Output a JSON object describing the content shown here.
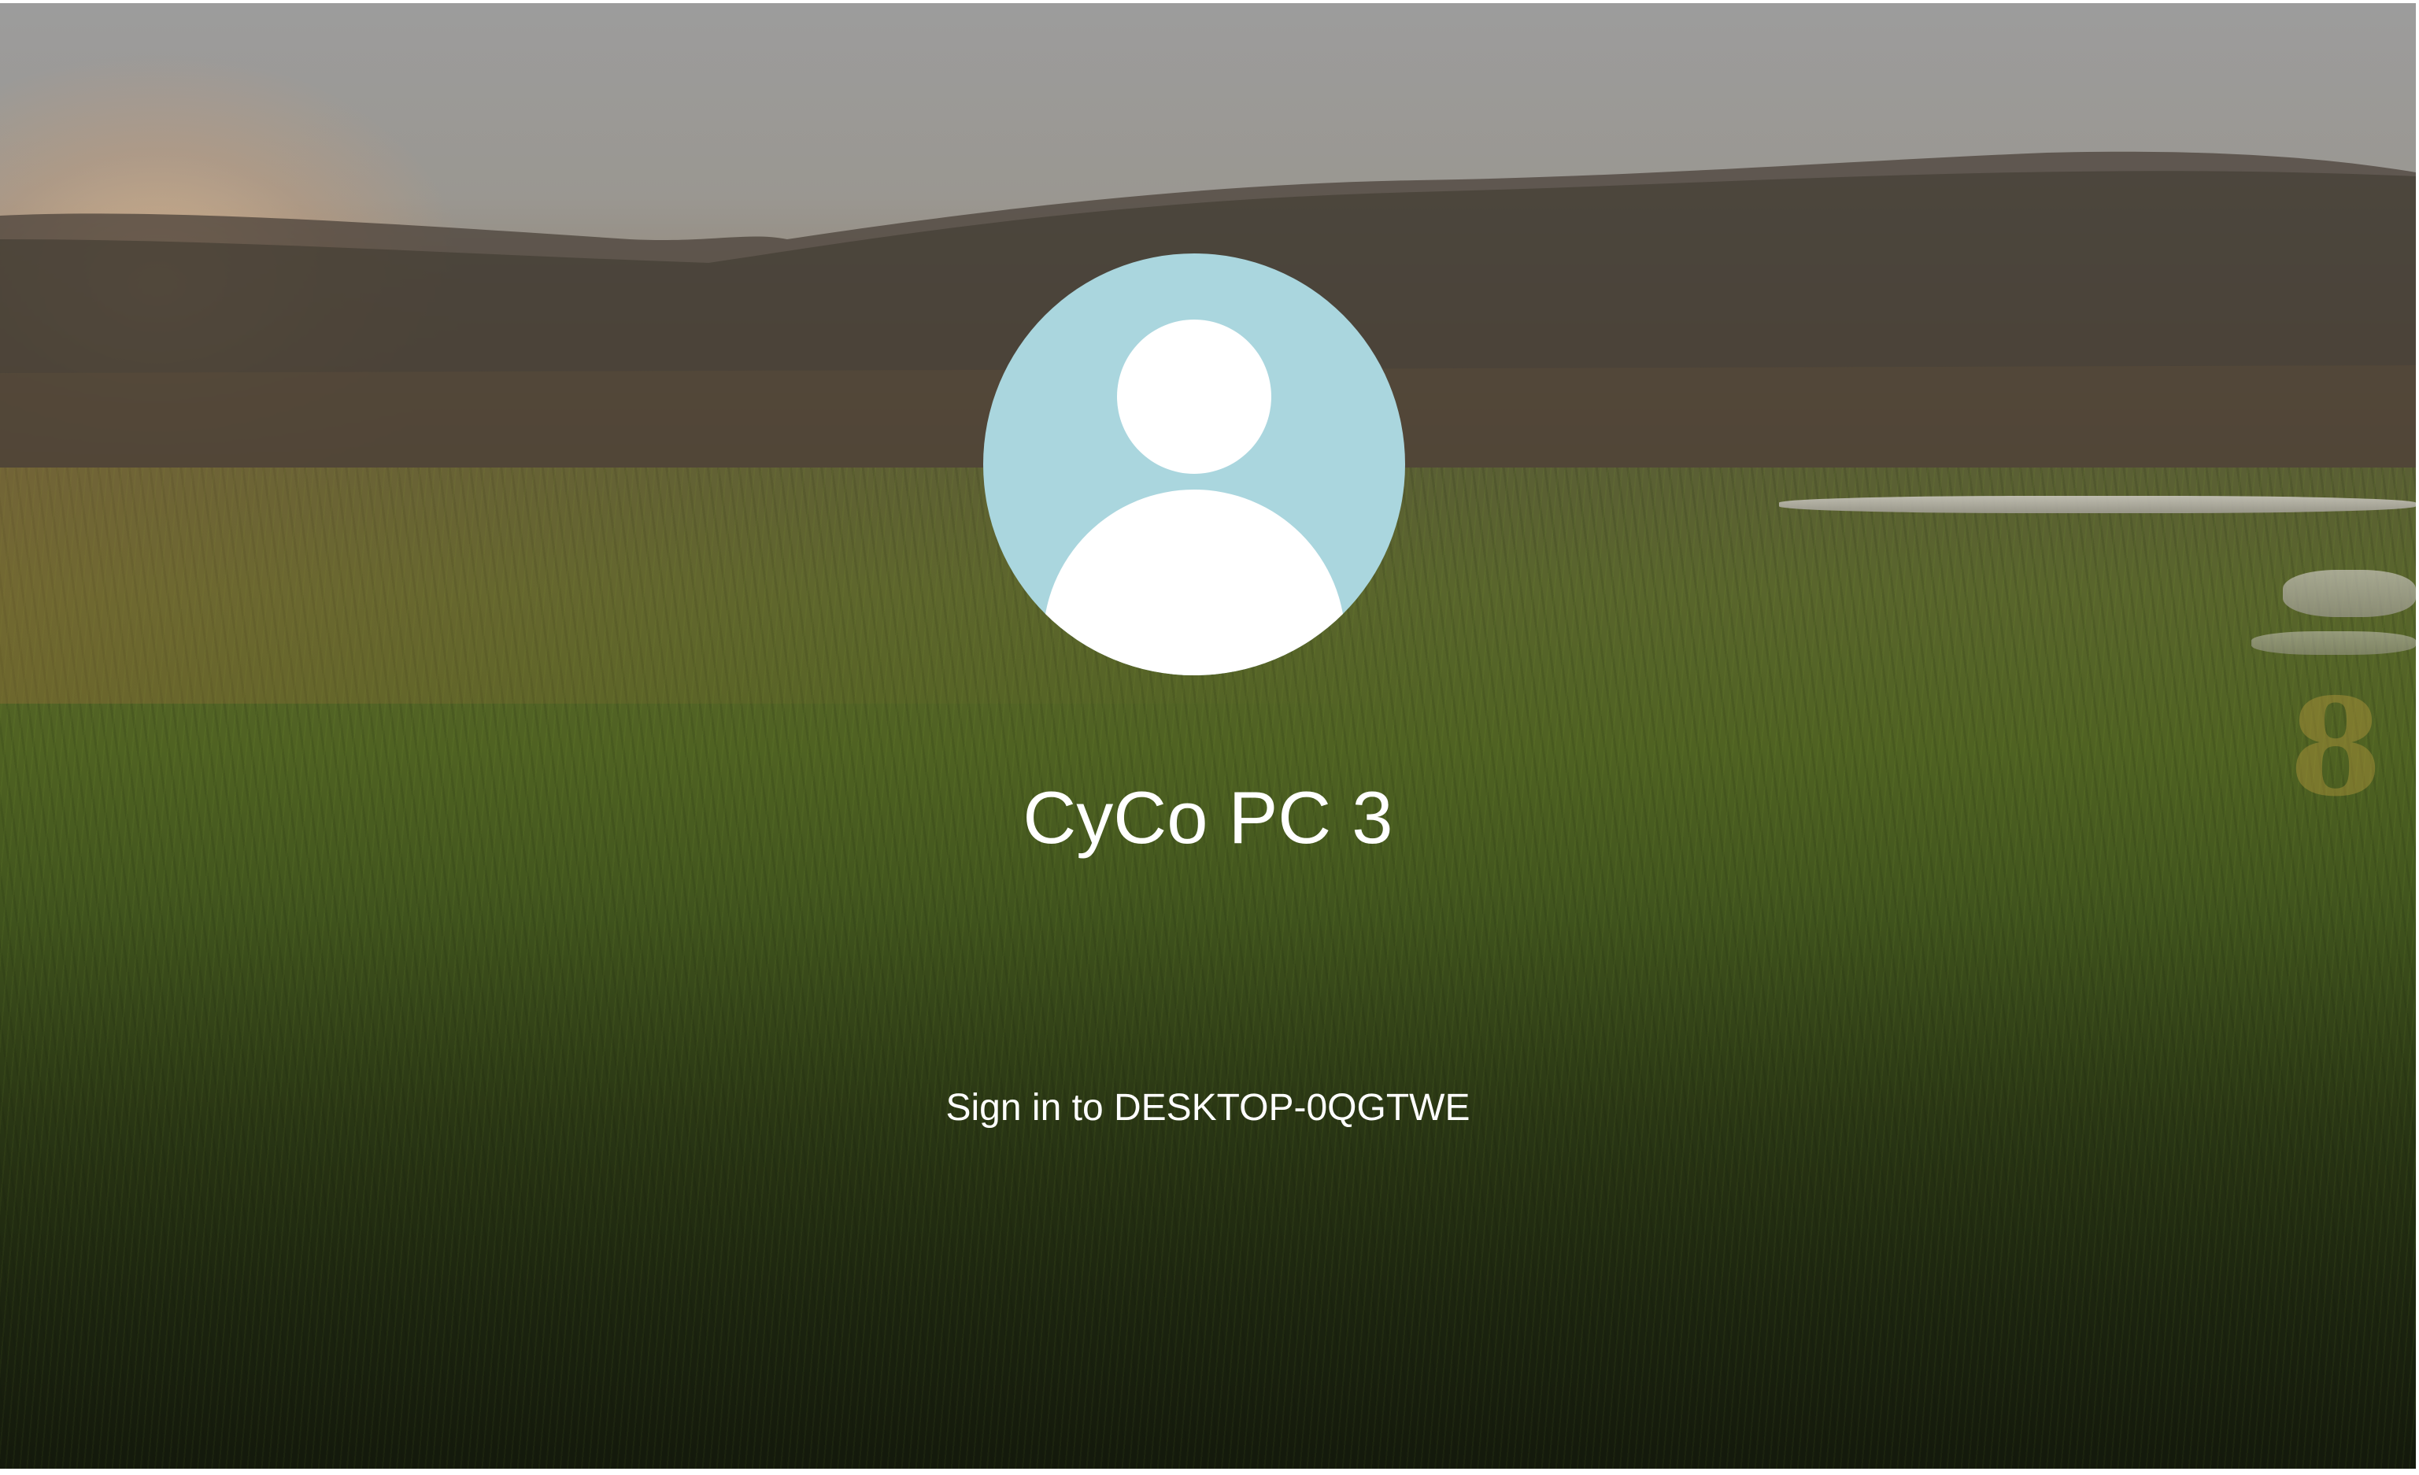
{
  "lock_screen": {
    "user": {
      "display_name": "CyCo PC 3",
      "avatar_icon": "default-user-icon",
      "avatar_color": "#aad6de"
    },
    "sign_in_target": "Sign in to DESKTOP-0QGTWE",
    "background": "grass-field-sunset-wallpaper",
    "corner_glyph": "8"
  }
}
